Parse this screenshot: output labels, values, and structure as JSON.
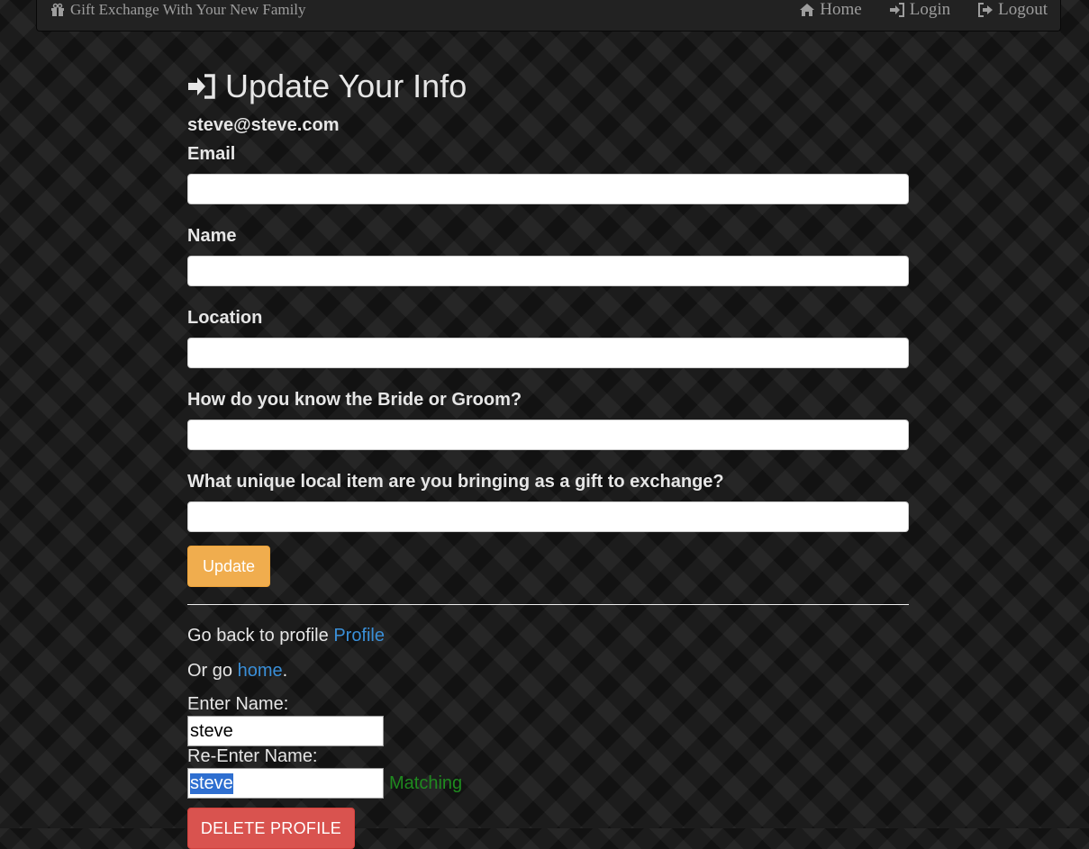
{
  "navbar": {
    "brand": "Gift Exchange With Your New Family",
    "links": [
      {
        "label": "Home",
        "icon": "home-icon"
      },
      {
        "label": "Login",
        "icon": "login-icon"
      },
      {
        "label": "Logout",
        "icon": "logout-icon"
      }
    ]
  },
  "page": {
    "title": "Update Your Info",
    "title_icon": "sign-in-icon",
    "user_email": "steve@steve.com"
  },
  "form": {
    "fields": [
      {
        "label": "Email",
        "value": ""
      },
      {
        "label": "Name",
        "value": ""
      },
      {
        "label": "Location",
        "value": ""
      },
      {
        "label": "How do you know the Bride or Groom?",
        "value": ""
      },
      {
        "label": "What unique local item are you bringing as a gift to exchange?",
        "value": ""
      }
    ],
    "submit_label": "Update"
  },
  "links": {
    "back_text": "Go back to profile ",
    "back_link": "Profile",
    "home_prefix": "Or go ",
    "home_link": "home",
    "home_suffix": "."
  },
  "delete": {
    "enter_label": "Enter Name:",
    "enter_value": "steve",
    "reenter_label": "Re-Enter Name:",
    "reenter_value": "steve",
    "match_status": "Matching",
    "button_label": "DELETE PROFILE"
  },
  "colors": {
    "update_button": "#f0ad4e",
    "delete_button": "#d9534f",
    "link": "#3a8fd8",
    "matching": "#1f8a1f"
  }
}
